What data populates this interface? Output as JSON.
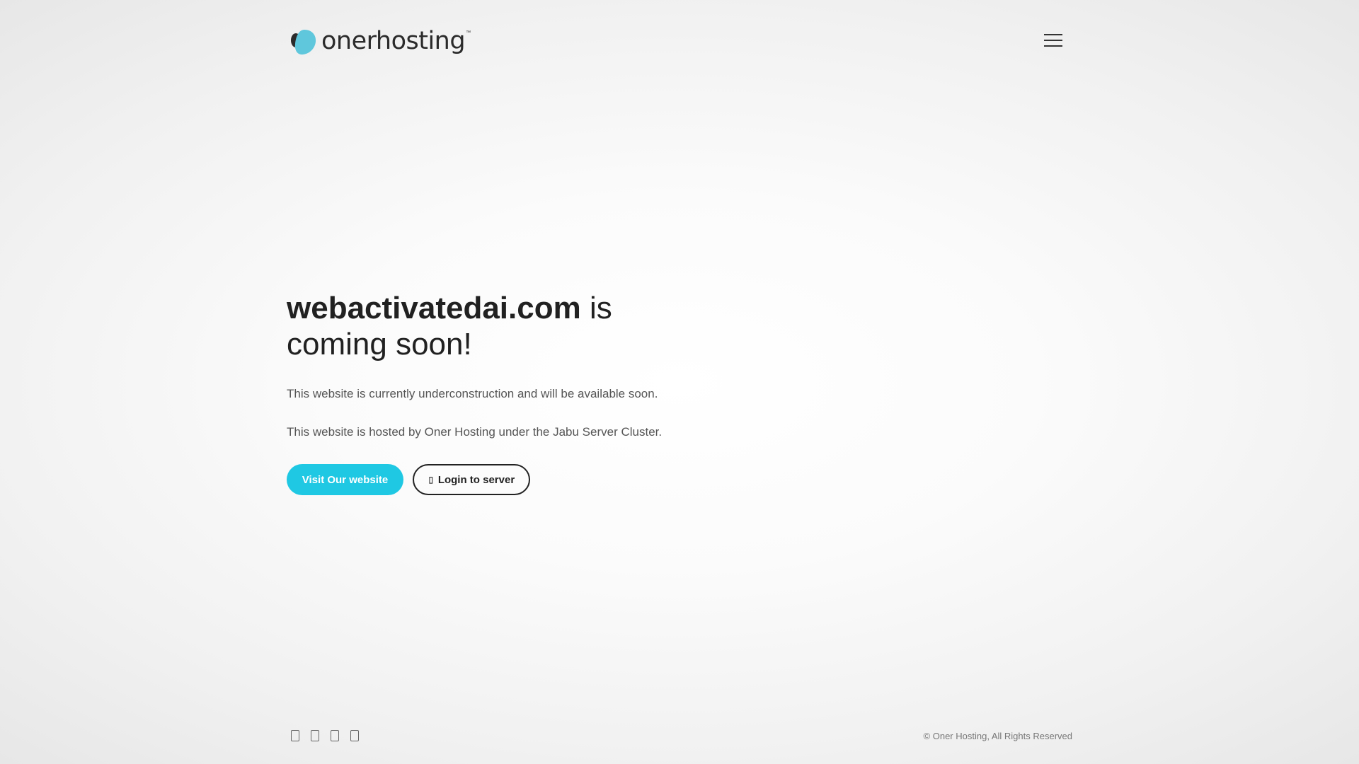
{
  "header": {
    "logo_text": "onerhosting",
    "logo_tm": "™",
    "logo_colors": {
      "accent": "#5fc7dc",
      "dark": "#2b2b2b"
    },
    "menu_icon": "hamburger-menu-icon"
  },
  "hero": {
    "domain": "webactivatedai.com",
    "headline_rest": " is coming soon!",
    "paragraph_1": "This website is currently underconstruction and will be available soon.",
    "paragraph_2": "This website is hosted by Oner Hosting under the Jabu Server Cluster."
  },
  "buttons": {
    "visit_label": "Visit Our website",
    "login_label": "Login to server",
    "login_icon": "lock-icon",
    "primary_color": "#1fc8e3"
  },
  "footer": {
    "social_icons": [
      "facebook-icon",
      "twitter-icon",
      "instagram-icon",
      "linkedin-icon"
    ],
    "copyright": "© Oner Hosting, All Rights Reserved"
  }
}
